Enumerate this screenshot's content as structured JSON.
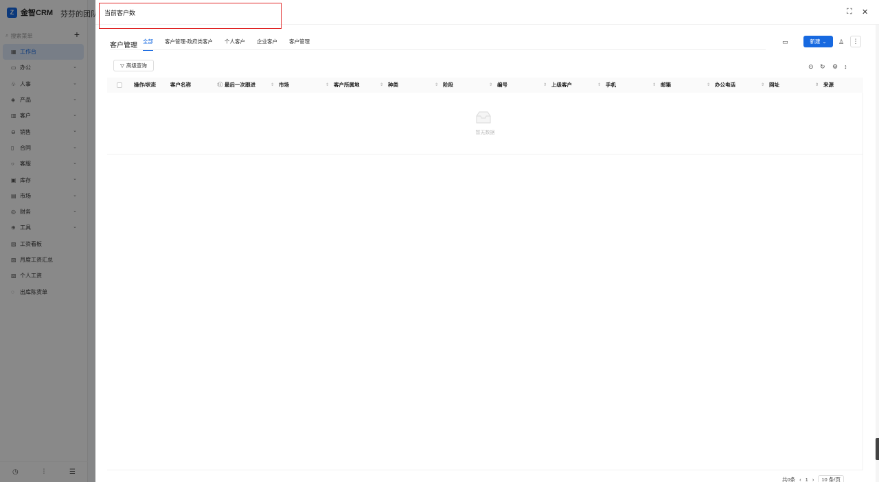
{
  "app": {
    "logo_text": "金智CRM",
    "team_name": "芬芬的团队(",
    "search_placeholder": "搜索菜单",
    "plus_icon": "+"
  },
  "sidebar": {
    "items": [
      {
        "label": "工作台",
        "icon": "▦",
        "chevron": false,
        "active": true
      },
      {
        "label": "办公",
        "icon": "▭",
        "chevron": true
      },
      {
        "label": "人事",
        "icon": "♧",
        "chevron": true
      },
      {
        "label": "产品",
        "icon": "◈",
        "chevron": true
      },
      {
        "label": "客户",
        "icon": "▥",
        "chevron": true
      },
      {
        "label": "销售",
        "icon": "⊖",
        "chevron": true
      },
      {
        "label": "合同",
        "icon": "▯",
        "chevron": true
      },
      {
        "label": "客服",
        "icon": "○",
        "chevron": true
      },
      {
        "label": "库存",
        "icon": "▣",
        "chevron": true
      },
      {
        "label": "市场",
        "icon": "▤",
        "chevron": true
      },
      {
        "label": "财务",
        "icon": "◎",
        "chevron": true
      },
      {
        "label": "工具",
        "icon": "⊕",
        "chevron": true
      },
      {
        "label": "工资看板",
        "icon": "▧",
        "chevron": false
      },
      {
        "label": "月度工资汇总",
        "icon": "▧",
        "chevron": false
      },
      {
        "label": "个人工资",
        "icon": "▧",
        "chevron": false
      },
      {
        "label": "出库陈货单",
        "icon": "◌",
        "chevron": false
      }
    ],
    "chevron_icon": "⌄",
    "bottom_icons": [
      "◷",
      "⫶",
      "☰"
    ]
  },
  "drawer": {
    "title": "当前客户数",
    "module_title": "客户管理",
    "tabs": [
      "全部",
      "客户管理-政府类客户",
      "个人客户",
      "企业客户",
      "客户管理"
    ],
    "active_tab": 0,
    "new_button": "新建",
    "filter_button": "高级查询",
    "columns": [
      "操作/状态",
      "客户名称",
      "最后一次跟进",
      "市场",
      "客户所属地",
      "种类",
      "阶段",
      "编号",
      "上级客户",
      "手机",
      "邮箱",
      "办公电话",
      "网址",
      "来源"
    ],
    "empty_text": "暂无数据",
    "pagination": {
      "total": "共0条",
      "prev": "‹",
      "page": "1",
      "next": "›",
      "page_size": "10 条/页"
    }
  },
  "colors": {
    "primary": "#1769e0",
    "highlight": "#e02424"
  }
}
